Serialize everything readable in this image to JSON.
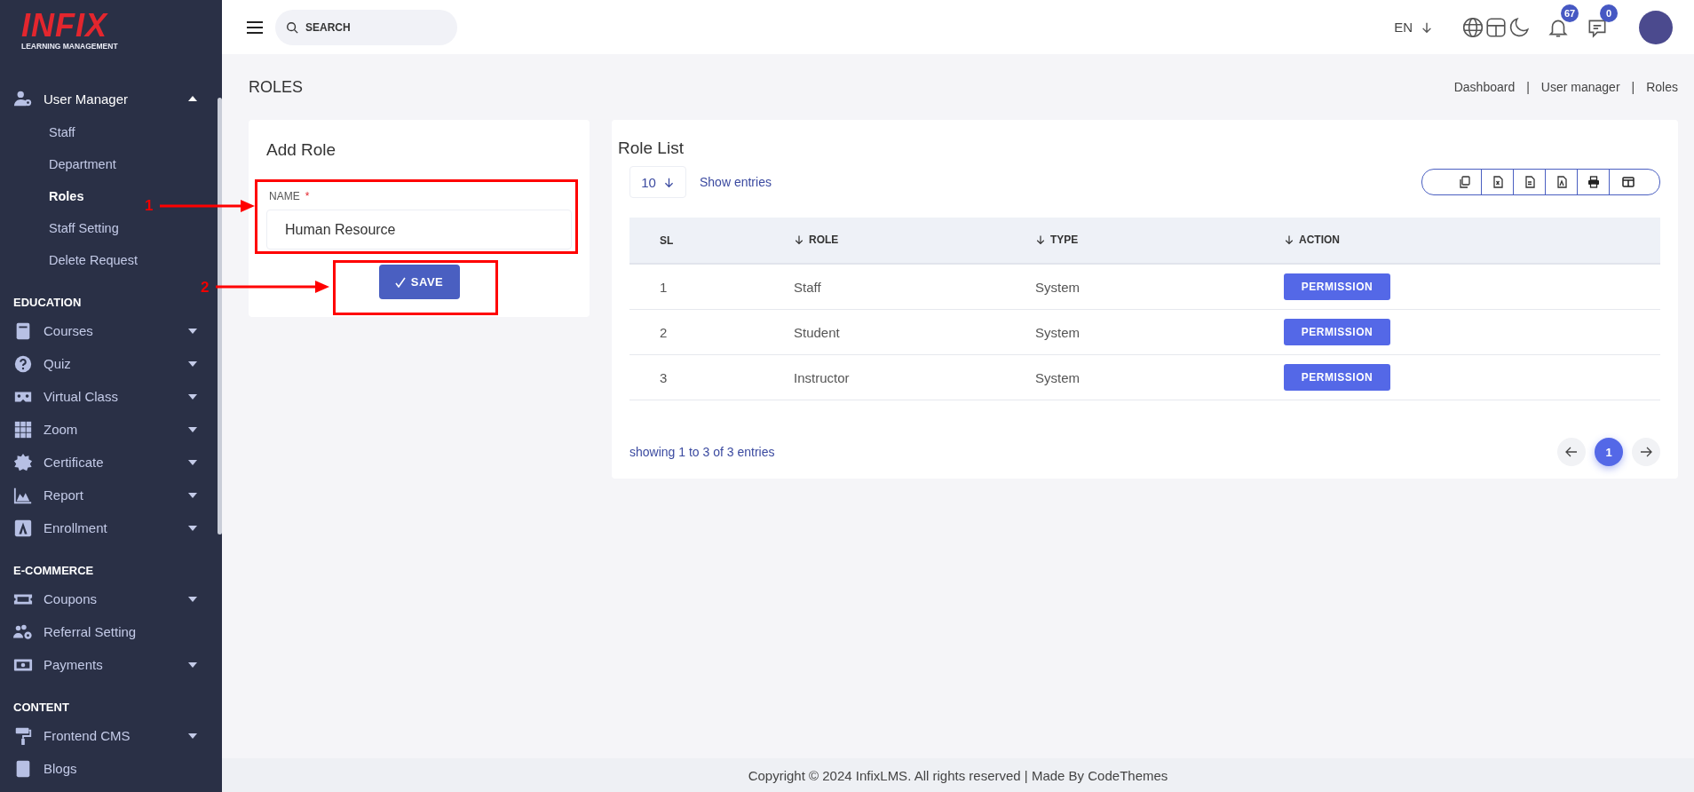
{
  "brand": {
    "logo": "INFIX",
    "tagline": "LEARNING MANAGEMENT"
  },
  "sidebar": {
    "groups": [
      {
        "items": [
          {
            "label": "User Manager",
            "expanded": true,
            "children": [
              {
                "label": "Staff",
                "selected": false
              },
              {
                "label": "Department",
                "selected": false
              },
              {
                "label": "Roles",
                "selected": true
              },
              {
                "label": "Staff Setting",
                "selected": false
              },
              {
                "label": "Delete Request",
                "selected": false
              }
            ]
          }
        ]
      },
      {
        "heading": "EDUCATION",
        "items": [
          {
            "label": "Courses",
            "expanded": false
          },
          {
            "label": "Quiz",
            "expanded": false
          },
          {
            "label": "Virtual Class",
            "expanded": false
          },
          {
            "label": "Zoom",
            "expanded": false
          },
          {
            "label": "Certificate",
            "expanded": false
          },
          {
            "label": "Report",
            "expanded": false
          },
          {
            "label": "Enrollment",
            "expanded": false
          }
        ]
      },
      {
        "heading": "E-COMMERCE",
        "items": [
          {
            "label": "Coupons",
            "expanded": false
          },
          {
            "label": "Referral Setting"
          },
          {
            "label": "Payments",
            "expanded": false
          }
        ]
      },
      {
        "heading": "CONTENT",
        "items": [
          {
            "label": "Frontend CMS",
            "expanded": false
          },
          {
            "label": "Blogs"
          }
        ]
      }
    ]
  },
  "topbar": {
    "search": {
      "placeholder": "SEARCH"
    },
    "language": "EN",
    "notifications_badge": "67",
    "messages_badge": "0"
  },
  "page": {
    "title": "ROLES",
    "breadcrumb": [
      "Dashboard",
      "User manager",
      "Roles"
    ],
    "breadcrumb_separator": "|"
  },
  "add_role": {
    "title": "Add Role",
    "field_label": "NAME",
    "required_mark": "*",
    "value": "Human Resource",
    "save_label": "SAVE"
  },
  "role_list": {
    "title": "Role List",
    "page_size": "10",
    "show_entries": "Show entries",
    "columns": [
      {
        "label": "SL",
        "sortable": false
      },
      {
        "label": "ROLE",
        "sortable": true
      },
      {
        "label": "TYPE",
        "sortable": true
      },
      {
        "label": "ACTION",
        "sortable": true
      }
    ],
    "rows": [
      {
        "sl": "1",
        "role": "Staff",
        "type": "System",
        "action": "PERMISSION"
      },
      {
        "sl": "2",
        "role": "Student",
        "type": "System",
        "action": "PERMISSION"
      },
      {
        "sl": "3",
        "role": "Instructor",
        "type": "System",
        "action": "PERMISSION"
      }
    ],
    "summary": "showing 1 to 3 of 3 entries",
    "pages": [
      {
        "label": "1",
        "selected": true
      }
    ]
  },
  "footer": "Copyright © 2024 InfixLMS. All rights reserved | Made By CodeThemes",
  "annotations": [
    {
      "label": "1"
    },
    {
      "label": "2"
    }
  ]
}
